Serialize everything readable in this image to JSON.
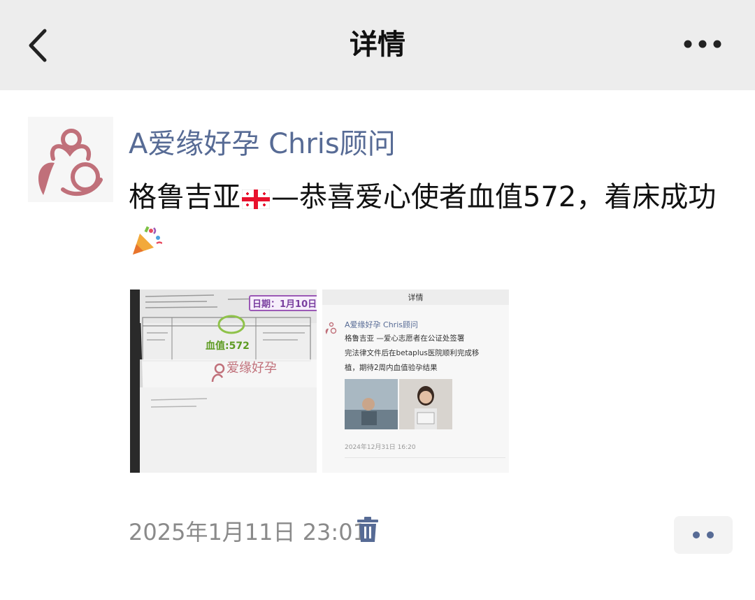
{
  "header": {
    "title": "详情",
    "back_icon": "chevron-left-icon",
    "more_icon": "more-horizontal-icon"
  },
  "post": {
    "author": "A爱缘好孕 Chris顾问",
    "text_before_flag": "格鲁吉亚",
    "text_after_flag": "—恭喜爱心使者血值572，着床成功",
    "timestamp": "2025年1月11日 23:01",
    "delete_icon": "trash-icon",
    "comment_icon": "comment-more-icon"
  },
  "photo1": {
    "date_stamp": "日期：1月10日",
    "value_label": "血值:572",
    "logo_text": "爱缘好孕"
  },
  "photo2": {
    "header_title": "详情",
    "author": "A爱缘好孕 Chris顾问",
    "lines": [
      "格鲁吉亚 —爱心志愿者在公证处签署",
      "完法律文件后在betaplus医院顺利完成移",
      "植，期待2周内血值验孕结果"
    ],
    "timestamp": "2024年12月31日 16:20"
  },
  "colors": {
    "author_link": "#576b95",
    "header_bg": "#ededed",
    "brand_pink": "#c0707a",
    "timestamp": "#8a8a8a"
  }
}
